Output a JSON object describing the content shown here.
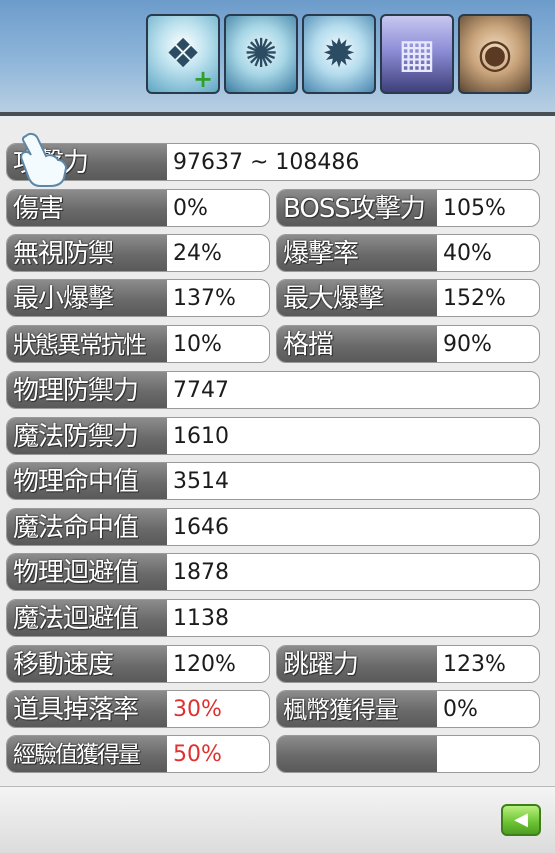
{
  "skill_icons": [
    {
      "name": "mech-wing-plus-icon"
    },
    {
      "name": "ice-gear-icon"
    },
    {
      "name": "ice-guardian-icon"
    },
    {
      "name": "gate-icon"
    },
    {
      "name": "round-emblem-icon"
    }
  ],
  "stats": {
    "attack": {
      "label": "攻擊力",
      "value": "97637 ~ 108486"
    },
    "damage": {
      "label": "傷害",
      "value": "0%"
    },
    "boss_attack": {
      "label": "BOSS攻擊力",
      "value": "105%"
    },
    "ignore_def": {
      "label": "無視防禦",
      "value": "24%"
    },
    "crit_rate": {
      "label": "爆擊率",
      "value": "40%"
    },
    "min_crit": {
      "label": "最小爆擊",
      "value": "137%"
    },
    "max_crit": {
      "label": "最大爆擊",
      "value": "152%"
    },
    "status_resist": {
      "label": "狀態異常抗性",
      "value": "10%"
    },
    "stance": {
      "label": "格擋",
      "value": "90%"
    },
    "phys_def": {
      "label": "物理防禦力",
      "value": "7747"
    },
    "magic_def": {
      "label": "魔法防禦力",
      "value": "1610"
    },
    "phys_acc": {
      "label": "物理命中值",
      "value": "3514"
    },
    "magic_acc": {
      "label": "魔法命中值",
      "value": "1646"
    },
    "phys_avoid": {
      "label": "物理迴避值",
      "value": "1878"
    },
    "magic_avoid": {
      "label": "魔法迴避值",
      "value": "1138"
    },
    "speed": {
      "label": "移動速度",
      "value": "120%"
    },
    "jump": {
      "label": "跳躍力",
      "value": "123%"
    },
    "drop_rate": {
      "label": "道具掉落率",
      "value": "30%"
    },
    "meso_rate": {
      "label": "楓幣獲得量",
      "value": "0%"
    },
    "exp_rate": {
      "label": "經驗值獲得量",
      "value": "50%"
    },
    "empty_slot": {
      "label": "",
      "value": ""
    }
  },
  "colors": {
    "highlight_value": "#e03030",
    "back_button": "#6ac232"
  },
  "footer": {
    "back_icon": "back-arrow-icon",
    "back_label": "◀"
  }
}
